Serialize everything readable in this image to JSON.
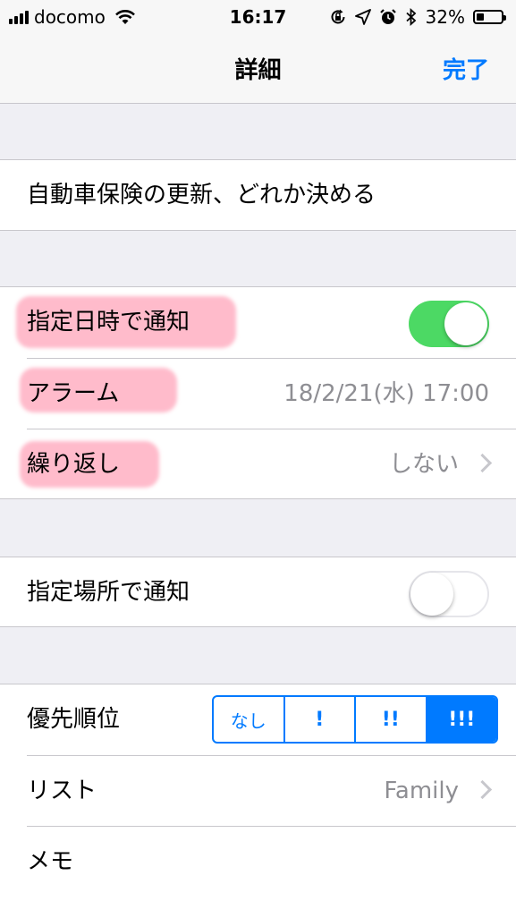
{
  "status_bar": {
    "carrier": "docomo",
    "time": "16:17",
    "battery_percent": "32%",
    "battery_level": 0.32,
    "icons": [
      "signal-icon",
      "wifi-icon",
      "rotation-lock-icon",
      "location-icon",
      "alarm-icon",
      "bluetooth-icon",
      "battery-icon"
    ]
  },
  "nav": {
    "title": "詳細",
    "done_label": "完了"
  },
  "reminder": {
    "title": "自動車保険の更新、どれか決める"
  },
  "notify_date": {
    "label": "指定日時で通知",
    "enabled": true,
    "alarm_label": "アラーム",
    "alarm_value": "18/2/21(水) 17:00",
    "repeat_label": "繰り返し",
    "repeat_value": "しない"
  },
  "notify_location": {
    "label": "指定場所で通知",
    "enabled": false
  },
  "priority": {
    "label": "優先順位",
    "options": [
      "なし",
      "!",
      "!!",
      "!!!"
    ],
    "selected": "!!!"
  },
  "list": {
    "label": "リスト",
    "value": "Family"
  },
  "memo": {
    "label": "メモ"
  },
  "colors": {
    "accent": "#007aff",
    "toggle_on": "#4cd964",
    "highlight": "#ff698c"
  }
}
